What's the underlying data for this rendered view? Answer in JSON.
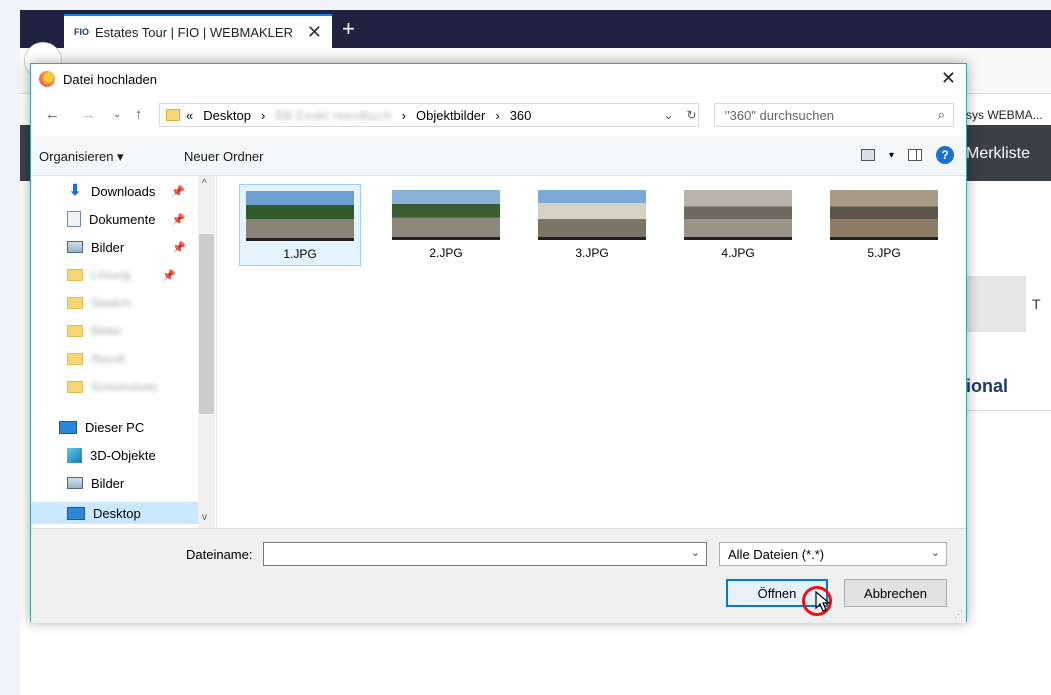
{
  "browser": {
    "tab_logo": "FIO",
    "tab_title": "Estates Tour | FIO | WEBMAKLER",
    "tab_close": "✕",
    "new_tab": "+",
    "bookmark_text": "sys WEBMA...",
    "nav_text": "Merkliste",
    "partial_text_right": "T",
    "heading_partial": "ional"
  },
  "dialog": {
    "title": "Datei hochladen",
    "close": "✕",
    "breadcrumb": [
      "Desktop",
      "BB Exakt Handbuch",
      "Objektbilder",
      "360"
    ],
    "breadcrumb_prefix": "«",
    "search_placeholder": "\"360\" durchsuchen",
    "toolbar": {
      "organize": "Organisieren ▾",
      "new_folder": "Neuer Ordner",
      "help": "?"
    },
    "nav": [
      {
        "label": "Downloads",
        "icon": "download-icon",
        "pinned": true
      },
      {
        "label": "Dokumente",
        "icon": "document-icon",
        "pinned": true
      },
      {
        "label": "Bilder",
        "icon": "pictures-icon",
        "pinned": true
      },
      {
        "label": "Lösung",
        "icon": "folder-icon",
        "pinned": true,
        "blurred": true
      },
      {
        "label": "Swatch",
        "icon": "folder-icon",
        "blurred": true
      },
      {
        "label": "Bilder",
        "icon": "folder-icon",
        "blurred": true
      },
      {
        "label": "Recolt",
        "icon": "folder-icon",
        "blurred": true
      },
      {
        "label": "Screenshots",
        "icon": "folder-icon",
        "blurred": true
      },
      {
        "label": "Dieser PC",
        "icon": "computer-icon"
      },
      {
        "label": "3D-Objekte",
        "icon": "3d-objects-icon"
      },
      {
        "label": "Bilder",
        "icon": "pictures-icon"
      },
      {
        "label": "Desktop",
        "icon": "desktop-icon",
        "selected": true
      }
    ],
    "files": [
      {
        "name": "1.JPG",
        "selected": true
      },
      {
        "name": "2.JPG"
      },
      {
        "name": "3.JPG"
      },
      {
        "name": "4.JPG"
      },
      {
        "name": "5.JPG"
      }
    ],
    "filename_label": "Dateiname:",
    "filename_value": "",
    "filter": "Alle Dateien (*.*)",
    "open_button": "Öffnen",
    "cancel_button": "Abbrechen"
  },
  "accent": "#0078d7"
}
